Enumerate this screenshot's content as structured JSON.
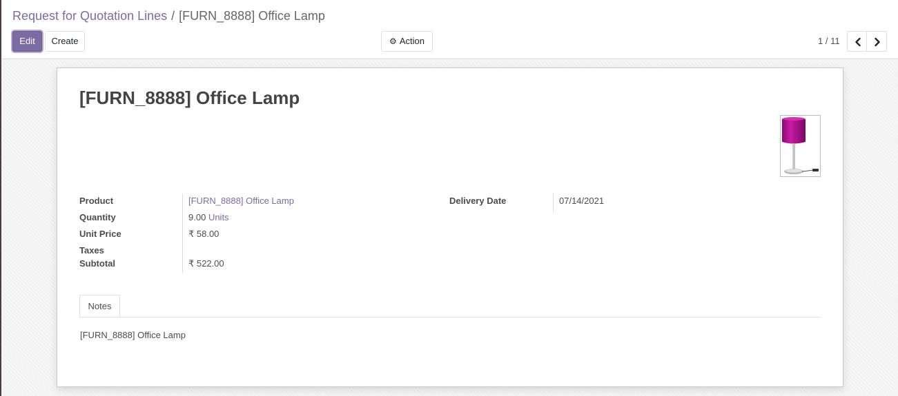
{
  "breadcrumb": {
    "parent": "Request for Quotation Lines",
    "separator": "/",
    "current": "[FURN_8888] Office Lamp"
  },
  "toolbar": {
    "edit_label": "Edit",
    "create_label": "Create",
    "action_label": "Action",
    "action_icon": "gear-icon"
  },
  "pager": {
    "value": "1 / 11",
    "prev_icon": "chevron-left-icon",
    "next_icon": "chevron-right-icon"
  },
  "record": {
    "title": "[FURN_8888] Office Lamp",
    "image": "office-lamp-image"
  },
  "fields": {
    "product_label": "Product",
    "product_value": "[FURN_8888] Office Lamp",
    "quantity_label": "Quantity",
    "quantity_value": "9.00",
    "quantity_uom": "Units",
    "unit_price_label": "Unit Price",
    "unit_price_value": "₹ 58.00",
    "taxes_label": "Taxes",
    "taxes_value": "",
    "subtotal_label": "Subtotal",
    "subtotal_value": "₹ 522.00",
    "delivery_date_label": "Delivery Date",
    "delivery_date_value": "07/14/2021"
  },
  "tabs": [
    {
      "label": "Notes",
      "active": true
    }
  ],
  "notes": {
    "text": "[FURN_8888] Office Lamp"
  },
  "colors": {
    "accent": "#7c6ba3",
    "lamp_shade": "#b0108f"
  }
}
